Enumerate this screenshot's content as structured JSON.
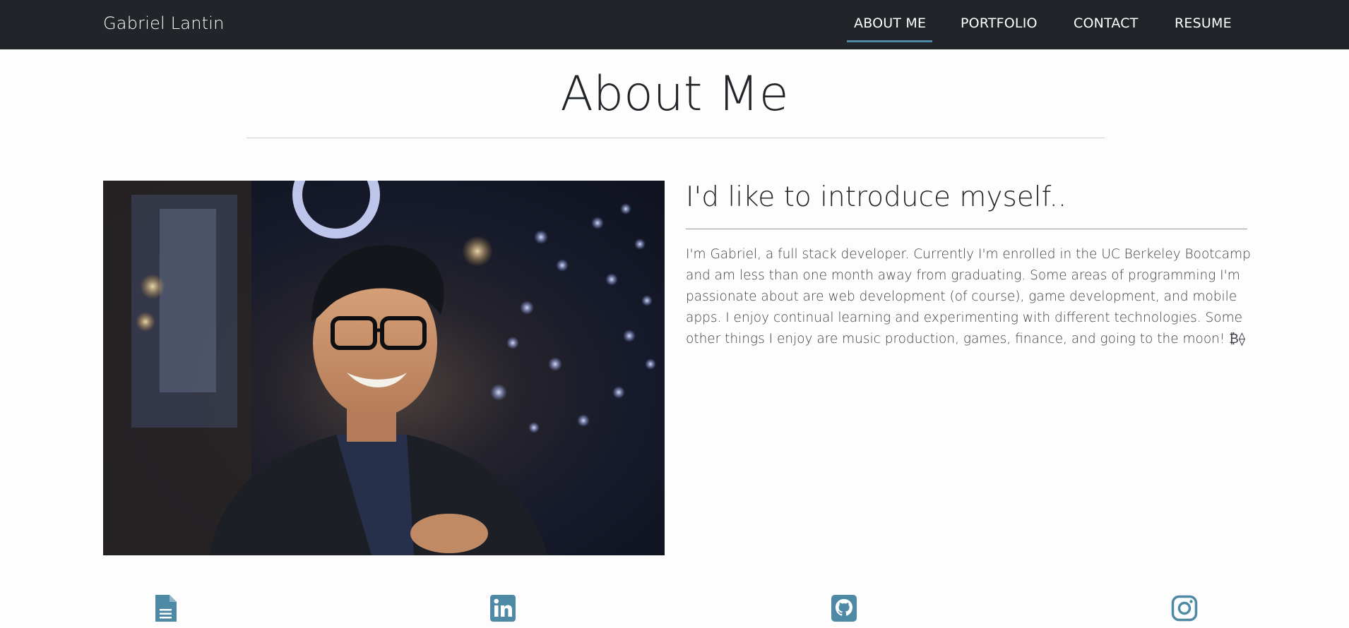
{
  "header": {
    "brand": "Gabriel Lantin",
    "nav": [
      {
        "label": "ABOUT ME",
        "active": true
      },
      {
        "label": "PORTFOLIO",
        "active": false
      },
      {
        "label": "CONTACT",
        "active": false
      },
      {
        "label": "RESUME",
        "active": false
      }
    ]
  },
  "main": {
    "title": "About Me",
    "intro_heading": "I'd like to introduce myself..",
    "bio": "I'm Gabriel, a full stack developer. Currently I'm enrolled in the UC Berkeley Bootcamp and am less than one month away from graduating. Some areas of programming I'm passionate about are web development (of course), game development, and mobile apps. I enjoy continual learning and experimenting with different technologies. Some other things I enjoy are music production, games, finance, and going to the moon! ₿⟠"
  },
  "social_icons": [
    "resume-document-icon",
    "linkedin-icon",
    "github-icon",
    "instagram-icon"
  ],
  "colors": {
    "navbar": "#212529",
    "accent": "#4e8aa6",
    "background": "#fdfdfd",
    "text": "#212529"
  }
}
